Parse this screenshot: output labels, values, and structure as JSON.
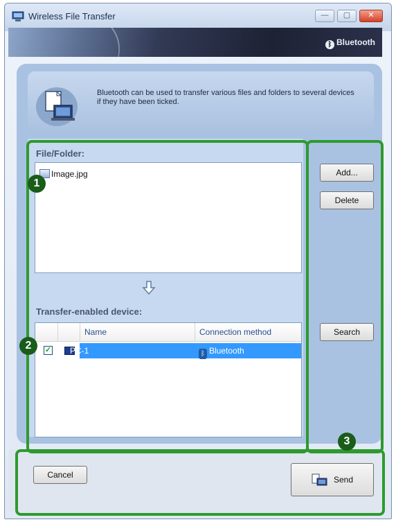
{
  "window": {
    "title": "Wireless File Transfer",
    "brand": "Bluetooth",
    "controls": {
      "minimize": "—",
      "maximize": "▢",
      "close": "✕"
    }
  },
  "description": "Bluetooth can be used to transfer various files and folders to several devices if they have been ticked.",
  "files": {
    "label": "File/Folder:",
    "items": [
      {
        "name": "Image.jpg"
      }
    ]
  },
  "devices": {
    "label": "Transfer-enabled device:",
    "columns": {
      "name": "Name",
      "connection": "Connection method"
    },
    "rows": [
      {
        "checked": true,
        "name": "PC-1",
        "connection": "Bluetooth"
      }
    ]
  },
  "buttons": {
    "add": "Add...",
    "delete": "Delete",
    "search": "Search",
    "cancel": "Cancel",
    "send": "Send"
  },
  "annotations": {
    "one": "1",
    "two": "2",
    "three": "3"
  },
  "icons": {
    "app": "computer-icon",
    "transfer": "file-transfer-icon",
    "arrow": "down-arrow-icon",
    "send": "send-icon",
    "bluetooth": "bluetooth-icon"
  },
  "colors": {
    "annotation_green": "#2e9a2e",
    "selection_blue": "#3399ff",
    "panel_blue": "#a9c2e2"
  }
}
